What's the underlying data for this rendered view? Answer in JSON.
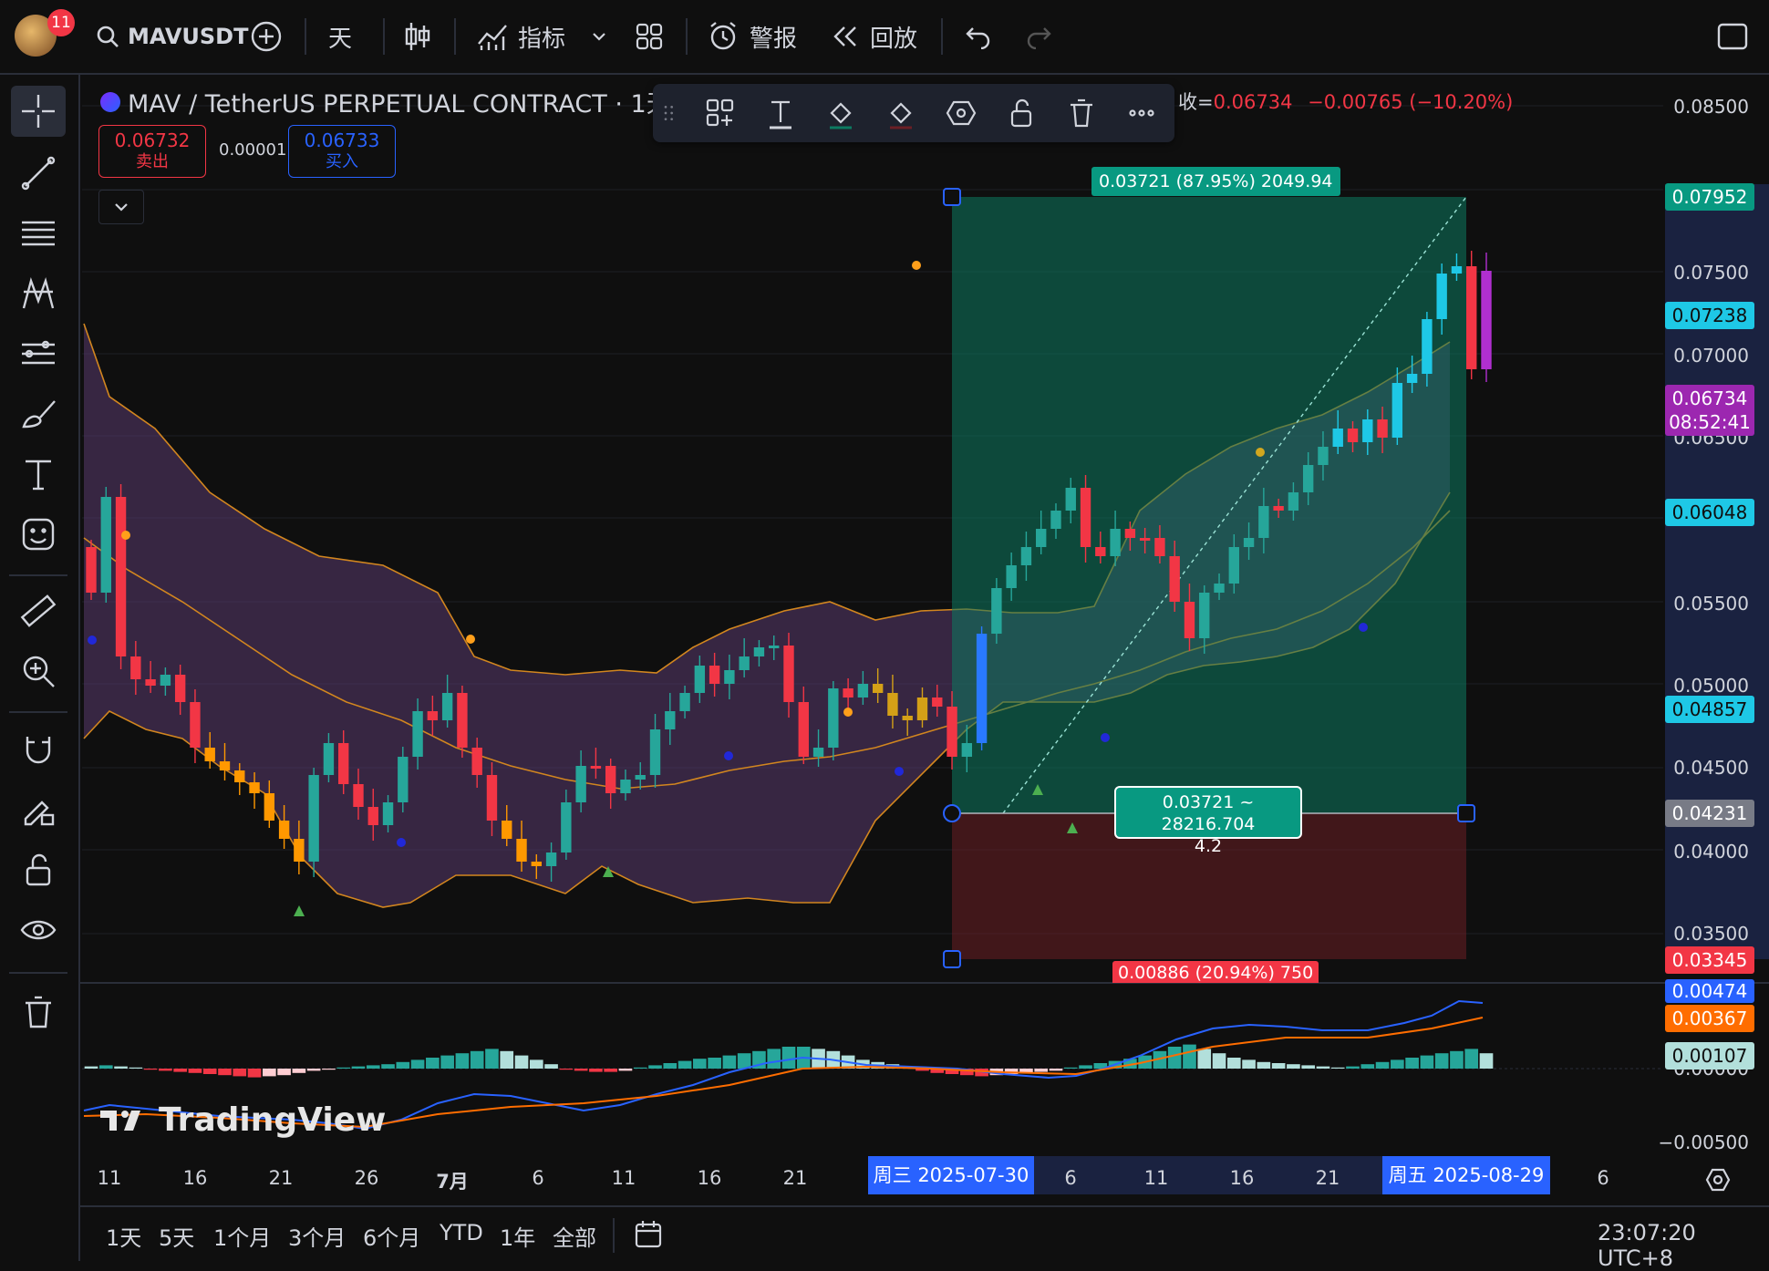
{
  "topbar": {
    "notif_count": "11",
    "symbol": "MAVUSDT",
    "interval": "天",
    "indicators": "指标",
    "alerts": "警报",
    "replay": "回放"
  },
  "legend": {
    "title": "MAV / TetherUS PERPETUAL CONTRACT · 1天 ·",
    "close_label": "收=",
    "close_value": "0.06734",
    "change": "−0.00765 (−10.20%)",
    "sell_price": "0.06732",
    "sell_label": "卖出",
    "spread": "0.00001",
    "buy_price": "0.06733",
    "buy_label": "买入"
  },
  "position_tool": {
    "target_label": "0.03721 (87.95%) 2049.94",
    "entry_label_line1": "0.03721 ~ 28216.704",
    "entry_label_line2": "4.2",
    "stop_label": "0.00886 (20.94%) 750"
  },
  "y_axis": {
    "ticks": [
      "0.08500",
      "0.07500",
      "0.07000",
      "0.06500",
      "0.05500",
      "0.05000",
      "0.04500",
      "0.04000",
      "0.03500"
    ],
    "tags": {
      "target": "0.07952",
      "t2": "0.07238",
      "last_price": "0.06734",
      "countdown": "08:52:41",
      "mid": "0.06048",
      "lower": "0.04857",
      "entry": "0.04231",
      "stop": "0.03345"
    }
  },
  "macd_axis": {
    "ticks": [
      "0.00000",
      "−0.00500"
    ],
    "macd": "0.00474",
    "signal": "0.00367",
    "hist": "0.00107"
  },
  "x_axis": {
    "ticks": [
      "11",
      "16",
      "21",
      "26",
      "7月",
      "6",
      "11",
      "16",
      "21",
      "6",
      "11",
      "16",
      "21",
      "6"
    ],
    "start_tag": "周三 2025-07-30",
    "end_tag": "周五 2025-08-29"
  },
  "watermark": "TradingView",
  "bottombar": {
    "ranges": [
      "1天",
      "5天",
      "1个月",
      "3个月",
      "6个月",
      "YTD",
      "1年",
      "全部"
    ],
    "clock": "23:07:20 UTC+8"
  },
  "colors": {
    "up": "#26a69a",
    "down": "#f23645",
    "accent": "#2962ff",
    "bb_fill": "#5a3a6e"
  }
}
